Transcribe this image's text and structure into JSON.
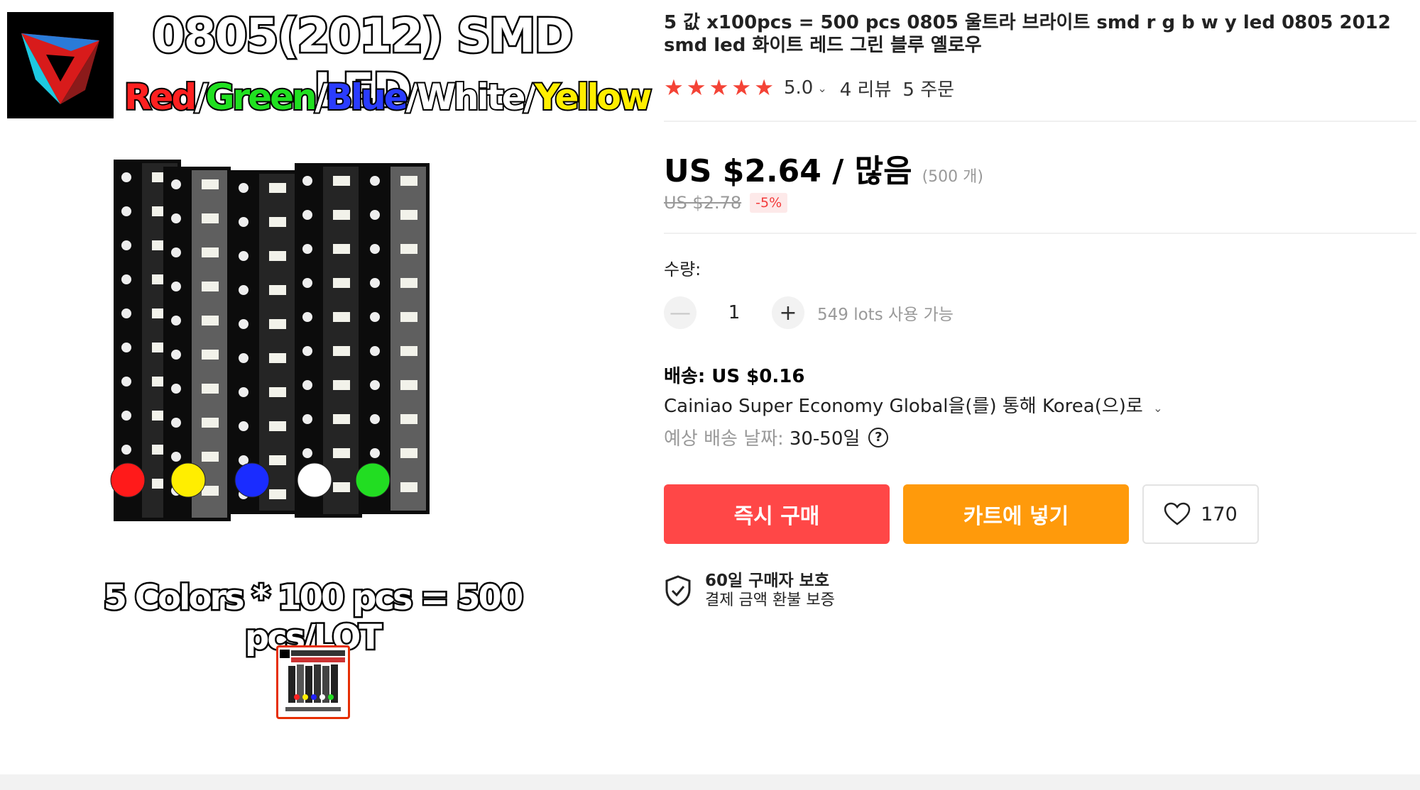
{
  "image": {
    "title": "0805(2012) SMD LED",
    "colors": [
      "Red",
      "Green",
      "Blue",
      "White",
      "Yellow"
    ],
    "caption": "5 Colors * 100 pcs = 500 pcs/LOT",
    "led_colors": [
      "#ff1a1a",
      "#ffee00",
      "#1a2cff",
      "#ffffff",
      "#22dd22"
    ]
  },
  "product": {
    "title": "5 값 x100pcs = 500 pcs 0805 울트라 브라이트 smd r g b w y led 0805 2012 smd led 화이트 레드 그린 블루 옐로우",
    "rating": "5.0",
    "reviews": "4 리뷰",
    "orders": "5 주문",
    "stars": 5
  },
  "price": {
    "current": "US $2.64 / 많음",
    "unit_note": "(500 개)",
    "original": "US $2.78",
    "discount": "-5%"
  },
  "quantity": {
    "label": "수량:",
    "value": "1",
    "available": "549 lots 사용 가능",
    "minus": "—",
    "plus": "+"
  },
  "shipping": {
    "cost": "배송: US $0.16",
    "method": "Cainiao Super Economy Global을(를) 통해 Korea(으)로",
    "eta_label": "예상 배송 날짜:",
    "eta_value": "30-50일",
    "help": "?"
  },
  "actions": {
    "buy_now": "즉시 구매",
    "add_to_cart": "카트에 넣기",
    "wishlist_count": "170"
  },
  "protection": {
    "title": "60일 구매자 보호",
    "subtitle": "결제 금액 환불 보증"
  },
  "icons": {
    "star": "star-icon",
    "chevron": "chevron-down-icon",
    "heart": "heart-icon",
    "shield": "shield-check-icon",
    "help": "help-icon"
  }
}
